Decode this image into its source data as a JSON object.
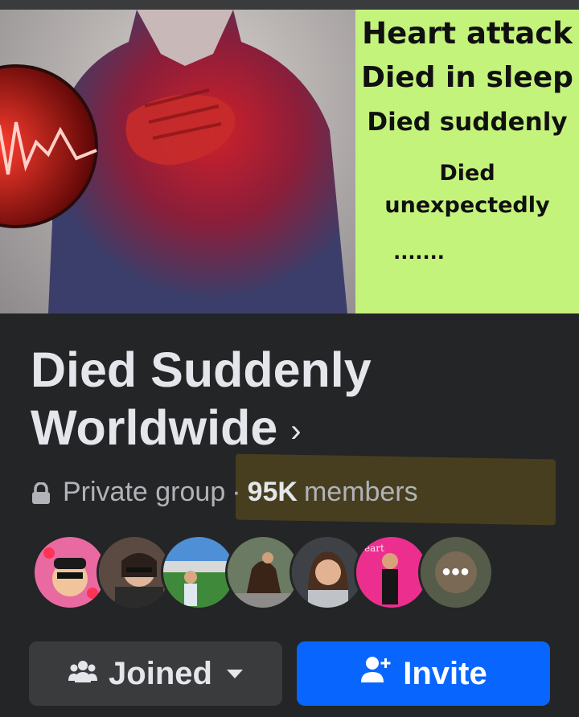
{
  "cover": {
    "lines": [
      "Heart attack",
      "Died in sleep",
      "Died suddenly",
      "Died",
      "unexpectedly",
      "......."
    ],
    "panel_color": "#c4f37c"
  },
  "group": {
    "name": "Died Suddenly Worldwide",
    "chevron": "›",
    "privacy": "Private group",
    "separator": "·",
    "members_count": "95K",
    "members_label": "members"
  },
  "avatars": {
    "count_shown": 7,
    "more_label": "•••"
  },
  "actions": {
    "joined_label": "Joined",
    "invite_label": "Invite"
  },
  "colors": {
    "background": "#242526",
    "primary_button": "#0866ff",
    "secondary_button": "#3a3b3c"
  },
  "icons": [
    "lock-icon",
    "chevron-right-icon",
    "group-people-icon",
    "caret-down-icon",
    "add-person-icon"
  ]
}
